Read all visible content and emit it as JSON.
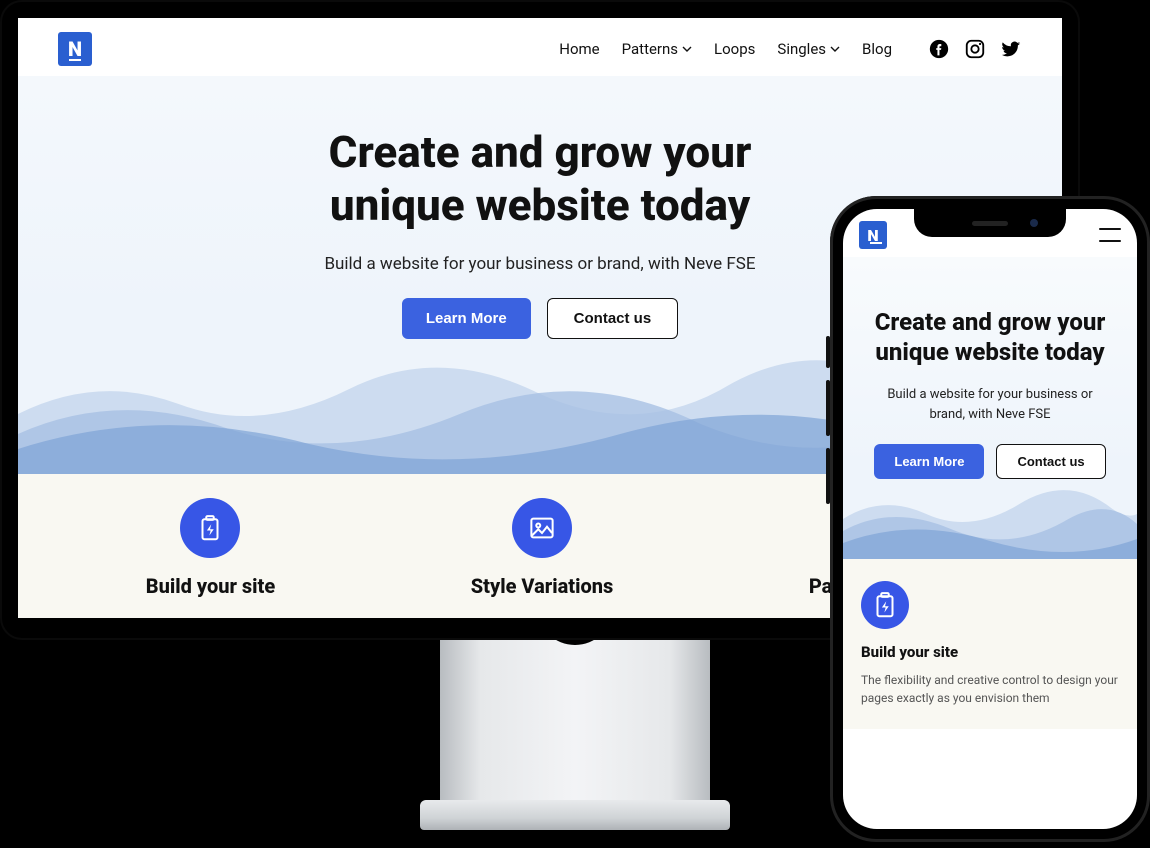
{
  "logo_letter": "N",
  "nav": {
    "items": [
      "Home",
      "Patterns",
      "Loops",
      "Singles",
      "Blog"
    ],
    "has_dropdown": [
      false,
      true,
      false,
      true,
      false
    ]
  },
  "hero": {
    "title_line1": "Create and grow your",
    "title_line2": "unique website today",
    "subtitle": "Build a website for your business or brand, with Neve FSE",
    "cta_primary": "Learn More",
    "cta_secondary": "Contact us"
  },
  "features": [
    {
      "icon": "battery-bolt",
      "title": "Build your site"
    },
    {
      "icon": "image",
      "title": "Style Variations"
    },
    {
      "icon": "download-doc",
      "title": "Pattern-ready"
    }
  ],
  "mobile": {
    "subtitle_line1": "Build a website for your business or",
    "subtitle_line2": "brand, with Neve FSE",
    "feature_title": "Build your site",
    "feature_desc": "The flexibility and creative control to design your pages exactly as you envision them"
  },
  "colors": {
    "accent": "#3b62e0",
    "logo": "#2a5fd0"
  }
}
